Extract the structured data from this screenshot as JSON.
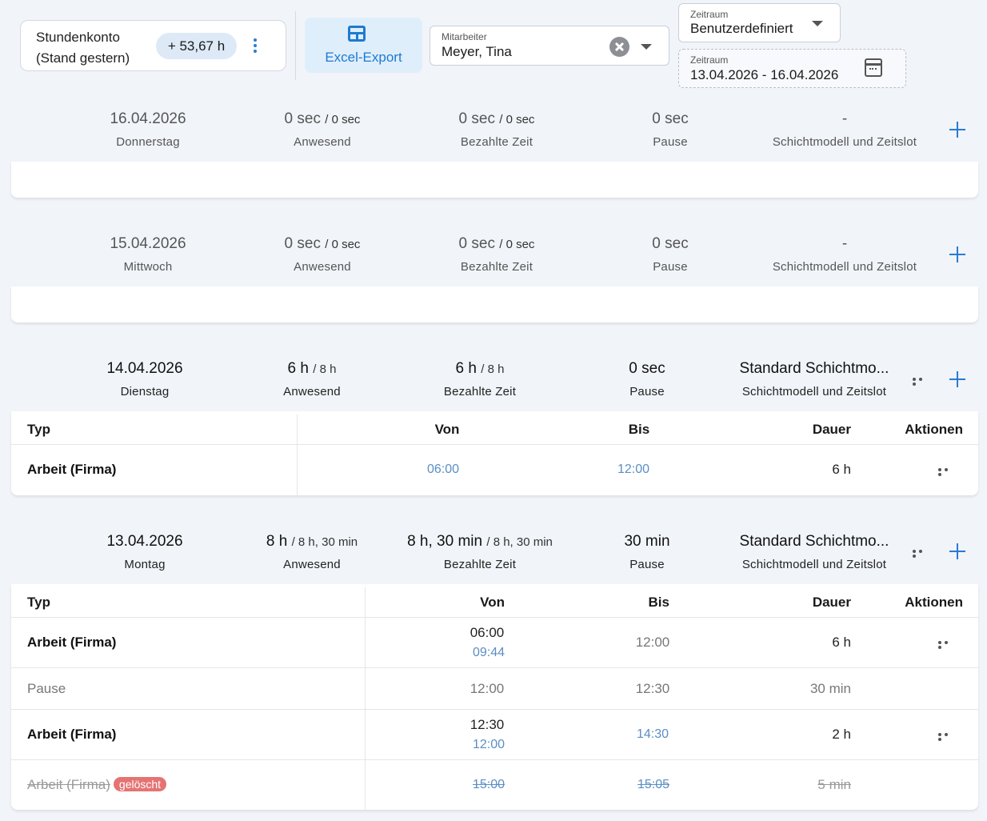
{
  "account": {
    "title_line1": "Stundenkonto",
    "title_line2": "(Stand gestern)",
    "hours": "+ 53,67 h"
  },
  "toolbar": {
    "excel_label": "Excel-Export"
  },
  "employee_filter": {
    "label": "Mitarbeiter",
    "value": "Meyer, Tina"
  },
  "period_select": {
    "label": "Zeitraum",
    "value": "Benutzerdefiniert"
  },
  "period_range": {
    "label": "Zeitraum",
    "value": "13.04.2026 - 16.04.2026"
  },
  "colors": {
    "accent": "#2a7bd2",
    "link": "#5b8ec4",
    "deleted_badge": "#e57373",
    "page_bg": "#f1f4f9"
  },
  "days": [
    {
      "date": "16.04.2026",
      "weekday": "Donnerstag",
      "present": "0 sec",
      "present_target": "/ 0 sec",
      "present_label": "Anwesend",
      "paid": "0 sec",
      "paid_target": "/ 0 sec",
      "paid_label": "Bezahlte Zeit",
      "pause": "0 sec",
      "pause_label": "Pause",
      "shift": "-",
      "shift_label": "Schichtmodell und Zeitslot"
    },
    {
      "date": "15.04.2026",
      "weekday": "Mittwoch",
      "present": "0 sec",
      "present_target": "/ 0 sec",
      "present_label": "Anwesend",
      "paid": "0 sec",
      "paid_target": "/ 0 sec",
      "paid_label": "Bezahlte Zeit",
      "pause": "0 sec",
      "pause_label": "Pause",
      "shift": "-",
      "shift_label": "Schichtmodell und Zeitslot"
    },
    {
      "date": "14.04.2026",
      "weekday": "Dienstag",
      "present": "6 h",
      "present_target": "/ 8 h",
      "present_label": "Anwesend",
      "paid": "6 h",
      "paid_target": "/ 8 h",
      "paid_label": "Bezahlte Zeit",
      "pause": "0 sec",
      "pause_label": "Pause",
      "shift": "Standard Schichtmo...",
      "shift_label": "Schichtmodell und Zeitslot",
      "table": {
        "headers": {
          "type": "Typ",
          "from": "Von",
          "to": "Bis",
          "duration": "Dauer",
          "actions": "Aktionen"
        },
        "rows": [
          {
            "type": "Arbeit (Firma)",
            "from": "06:00",
            "to": "12:00",
            "duration": "6 h"
          }
        ]
      }
    },
    {
      "date": "13.04.2026",
      "weekday": "Montag",
      "present": "8 h",
      "present_target": "/ 8 h, 30 min",
      "present_label": "Anwesend",
      "paid": "8 h, 30 min",
      "paid_target": "/ 8 h, 30 min",
      "paid_label": "Bezahlte Zeit",
      "pause": "30 min",
      "pause_label": "Pause",
      "shift": "Standard Schichtmo...",
      "shift_label": "Schichtmodell und Zeitslot",
      "table": {
        "headers": {
          "type": "Typ",
          "from": "Von",
          "to": "Bis",
          "duration": "Dauer",
          "actions": "Aktionen"
        },
        "rows": [
          {
            "type": "Arbeit (Firma)",
            "from": "06:00",
            "from_original": "09:44",
            "to": "12:00",
            "duration": "6 h"
          },
          {
            "type": "Pause",
            "from": "12:00",
            "to": "12:30",
            "duration": "30 min"
          },
          {
            "type": "Arbeit (Firma)",
            "from": "12:30",
            "from_original": "12:00",
            "to": "14:30",
            "duration": "2 h"
          },
          {
            "type": "Arbeit (Firma)",
            "badge": "gelöscht",
            "from": "15:00",
            "to": "15:05",
            "duration": "5 min"
          }
        ]
      }
    }
  ]
}
